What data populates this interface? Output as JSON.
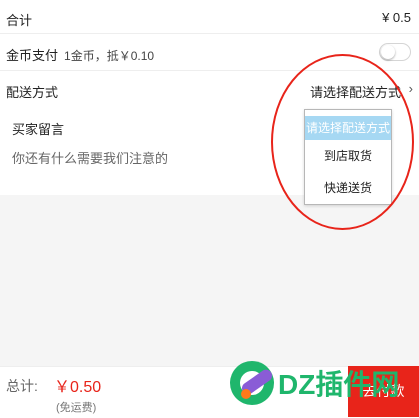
{
  "total_row": {
    "label": "合计",
    "value": "¥ 0.5"
  },
  "coin_row": {
    "label": "金币支付",
    "detail": "1金币，抵￥0.10",
    "enabled": false
  },
  "shipping_row": {
    "label": "配送方式",
    "value": "请选择配送方式",
    "chevron_icon": "chevron-right-icon"
  },
  "message": {
    "title": "买家留言",
    "placeholder": "你还有什么需要我们注意的"
  },
  "shipping_options": [
    "请选择配送方式",
    "到店取货",
    "快递送货"
  ],
  "selected_option_index": 0,
  "footer": {
    "total_label": "总计:",
    "total_amount": "￥0.50",
    "shipping_note": "(免运费)",
    "pay_button": "去付款"
  },
  "watermark": {
    "text": "DZ插件网"
  },
  "colors": {
    "accent_red": "#e8241a",
    "dropdown_highlight": "#a6d8f3"
  }
}
